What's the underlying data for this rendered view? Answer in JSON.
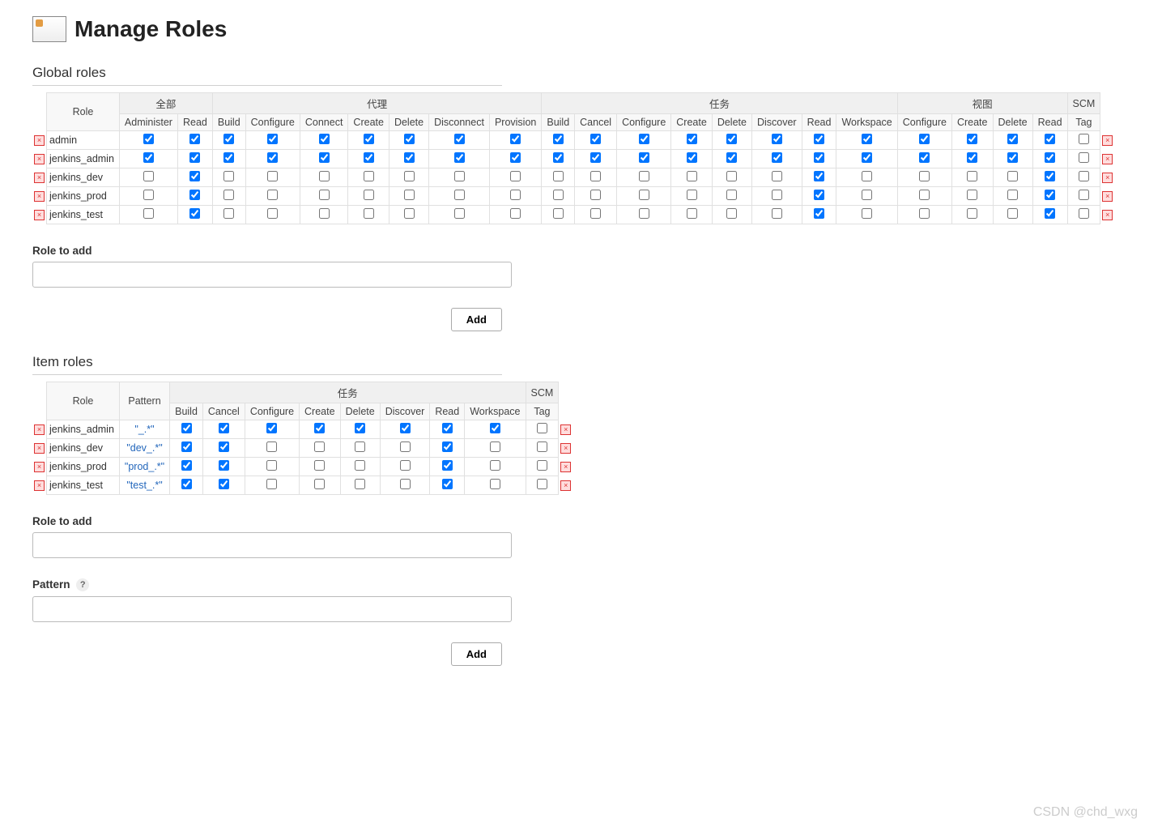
{
  "header": {
    "title": "Manage Roles"
  },
  "global": {
    "title": "Global roles",
    "role_header": "Role",
    "groups": [
      {
        "label": "全部",
        "cols": [
          "Administer",
          "Read"
        ]
      },
      {
        "label": "代理",
        "cols": [
          "Build",
          "Configure",
          "Connect",
          "Create",
          "Delete",
          "Disconnect",
          "Provision"
        ]
      },
      {
        "label": "任务",
        "cols": [
          "Build",
          "Cancel",
          "Configure",
          "Create",
          "Delete",
          "Discover",
          "Read",
          "Workspace"
        ]
      },
      {
        "label": "视图",
        "cols": [
          "Configure",
          "Create",
          "Delete",
          "Read"
        ]
      },
      {
        "label": "SCM",
        "cols": [
          "Tag"
        ]
      }
    ],
    "rows": [
      {
        "name": "admin",
        "checks": [
          true,
          true,
          true,
          true,
          true,
          true,
          true,
          true,
          true,
          true,
          true,
          true,
          true,
          true,
          true,
          true,
          true,
          true,
          true,
          true,
          true,
          false
        ]
      },
      {
        "name": "jenkins_admin",
        "checks": [
          true,
          true,
          true,
          true,
          true,
          true,
          true,
          true,
          true,
          true,
          true,
          true,
          true,
          true,
          true,
          true,
          true,
          true,
          true,
          true,
          true,
          false
        ]
      },
      {
        "name": "jenkins_dev",
        "checks": [
          false,
          true,
          false,
          false,
          false,
          false,
          false,
          false,
          false,
          false,
          false,
          false,
          false,
          false,
          false,
          true,
          false,
          false,
          false,
          false,
          true,
          false
        ]
      },
      {
        "name": "jenkins_prod",
        "checks": [
          false,
          true,
          false,
          false,
          false,
          false,
          false,
          false,
          false,
          false,
          false,
          false,
          false,
          false,
          false,
          true,
          false,
          false,
          false,
          false,
          true,
          false
        ]
      },
      {
        "name": "jenkins_test",
        "checks": [
          false,
          true,
          false,
          false,
          false,
          false,
          false,
          false,
          false,
          false,
          false,
          false,
          false,
          false,
          false,
          true,
          false,
          false,
          false,
          false,
          true,
          false
        ]
      }
    ],
    "role_to_add_label": "Role to add",
    "add_button": "Add"
  },
  "item": {
    "title": "Item roles",
    "role_header": "Role",
    "pattern_header": "Pattern",
    "groups": [
      {
        "label": "任务",
        "cols": [
          "Build",
          "Cancel",
          "Configure",
          "Create",
          "Delete",
          "Discover",
          "Read",
          "Workspace"
        ]
      },
      {
        "label": "SCM",
        "cols": [
          "Tag"
        ]
      }
    ],
    "rows": [
      {
        "name": "jenkins_admin",
        "pattern": "\"_.*\"",
        "checks": [
          true,
          true,
          true,
          true,
          true,
          true,
          true,
          true,
          false
        ]
      },
      {
        "name": "jenkins_dev",
        "pattern": "\"dev_.*\"",
        "checks": [
          true,
          true,
          false,
          false,
          false,
          false,
          true,
          false,
          false
        ]
      },
      {
        "name": "jenkins_prod",
        "pattern": "\"prod_.*\"",
        "checks": [
          true,
          true,
          false,
          false,
          false,
          false,
          true,
          false,
          false
        ]
      },
      {
        "name": "jenkins_test",
        "pattern": "\"test_.*\"",
        "checks": [
          true,
          true,
          false,
          false,
          false,
          false,
          true,
          false,
          false
        ]
      }
    ],
    "role_to_add_label": "Role to add",
    "pattern_label": "Pattern",
    "add_button": "Add"
  },
  "watermark": "CSDN @chd_wxg"
}
